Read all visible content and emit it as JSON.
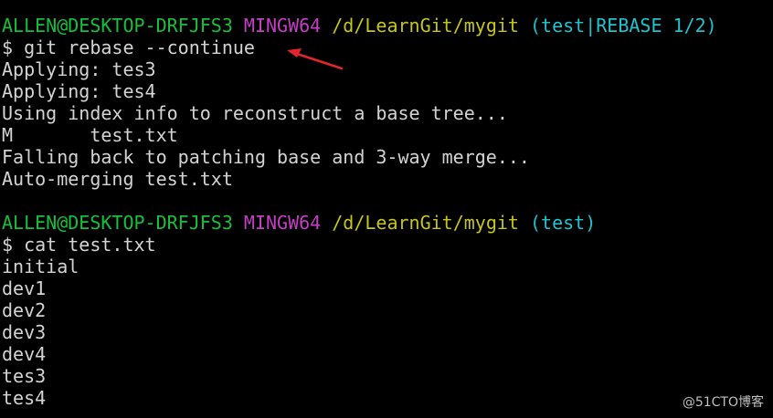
{
  "prompt1": {
    "user_host": "ALLEN@DESKTOP-DRFJFS3",
    "system": "MINGW64",
    "path": "/d/LearnGit/mygit",
    "branch": "(test|REBASE 1/2)"
  },
  "command1": "$ git rebase --continue",
  "output1": [
    "Applying: tes3",
    "Applying: tes4",
    "Using index info to reconstruct a base tree...",
    "M       test.txt",
    "Falling back to patching base and 3-way merge...",
    "Auto-merging test.txt"
  ],
  "prompt2": {
    "user_host": "ALLEN@DESKTOP-DRFJFS3",
    "system": "MINGW64",
    "path": "/d/LearnGit/mygit",
    "branch": "(test)"
  },
  "command2": "$ cat test.txt",
  "output2": [
    "initial",
    "dev1",
    "dev2",
    "dev3",
    "dev4",
    "tes3",
    "tes4"
  ],
  "watermark": "@51CTO博客",
  "colors": {
    "background": "#000000",
    "text": "#d3d3d3",
    "user_host": "#13c13c",
    "system": "#c63dc6",
    "path": "#c5c51a",
    "branch": "#1cc4cf",
    "arrow": "#e0262b"
  },
  "annotation": {
    "icon": "red-arrow-icon"
  }
}
